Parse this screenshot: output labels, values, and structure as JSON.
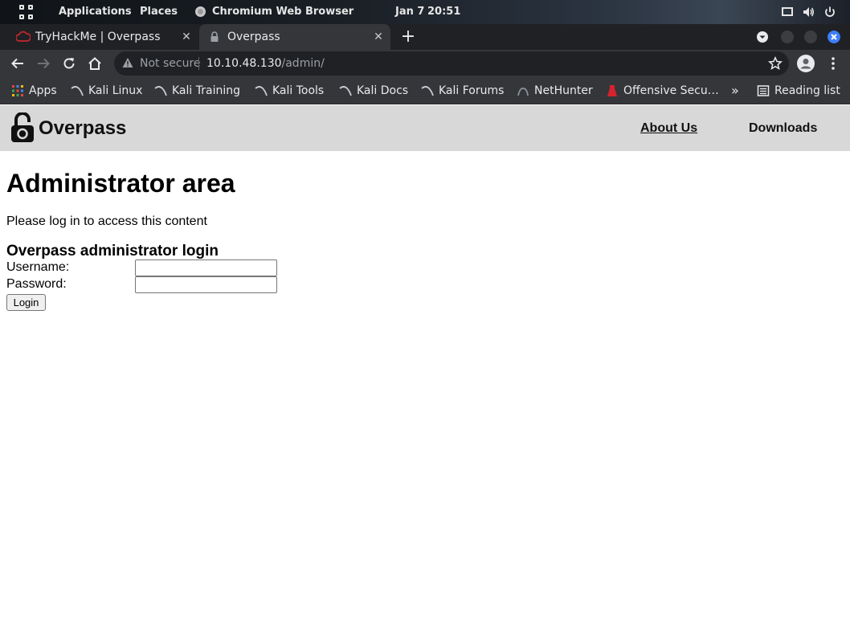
{
  "topbar": {
    "applications": "Applications",
    "places": "Places",
    "active_app": "Chromium Web Browser",
    "date": "Jan 7",
    "time": "20:51"
  },
  "tabs": [
    {
      "title": "TryHackMe | Overpass",
      "active": false
    },
    {
      "title": "Overpass",
      "active": true
    }
  ],
  "omnibox": {
    "security_label": "Not secure",
    "url_host": "10.10.48.130",
    "url_path": "/admin/"
  },
  "bookmarks": {
    "items": [
      {
        "label": "Apps",
        "icon": "apps-grid-icon"
      },
      {
        "label": "Kali Linux",
        "icon": "kali-dragon-icon"
      },
      {
        "label": "Kali Training",
        "icon": "kali-dragon-icon"
      },
      {
        "label": "Kali Tools",
        "icon": "kali-dragon-icon"
      },
      {
        "label": "Kali Docs",
        "icon": "kali-dragon-icon"
      },
      {
        "label": "Kali Forums",
        "icon": "kali-dragon-icon"
      },
      {
        "label": "NetHunter",
        "icon": "nethunter-icon"
      },
      {
        "label": "Offensive Secu…",
        "icon": "offsec-icon"
      }
    ],
    "overflow": "»",
    "reading_list": "Reading list"
  },
  "site": {
    "name": "Overpass",
    "nav": {
      "about": "About Us",
      "downloads": "Downloads"
    }
  },
  "main": {
    "title": "Administrator area",
    "intro": "Please log in to access this content",
    "form": {
      "title": "Overpass administrator login",
      "username_label": "Username:",
      "username_value": "",
      "password_label": "Password:",
      "password_value": "",
      "submit_label": "Login"
    }
  },
  "colors": {
    "browser_dark": "#202124",
    "browser_toolbar": "#35363a",
    "site_header_bg": "#d8d8d8",
    "close_button_blue": "#3d7eff"
  }
}
